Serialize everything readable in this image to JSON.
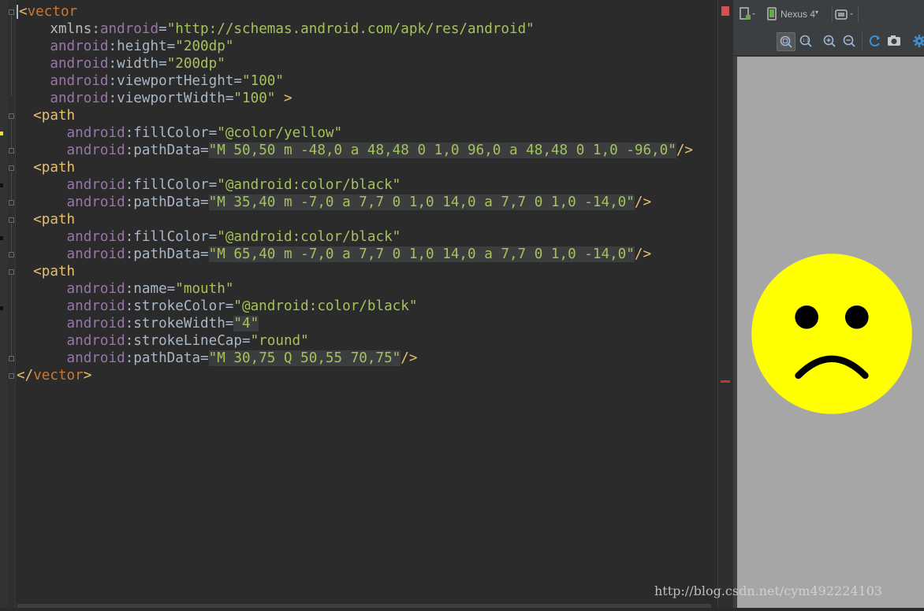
{
  "editor": {
    "lines": [
      [
        [
          "tag",
          "<"
        ],
        [
          "tag-red",
          "vector"
        ]
      ],
      [
        [
          "attr",
          "    xmlns"
        ],
        [
          "eq",
          ":"
        ],
        [
          "ns",
          "android"
        ],
        [
          "eq",
          "="
        ],
        [
          "str",
          "\"http://schemas.android.com/apk/res/android\""
        ]
      ],
      [
        [
          "ns",
          "    android"
        ],
        [
          "eq",
          ":height="
        ],
        [
          "str",
          "\"200dp\""
        ]
      ],
      [
        [
          "ns",
          "    android"
        ],
        [
          "eq",
          ":width="
        ],
        [
          "str",
          "\"200dp\""
        ]
      ],
      [
        [
          "ns",
          "    android"
        ],
        [
          "eq",
          ":viewportHeight="
        ],
        [
          "str",
          "\"100\""
        ]
      ],
      [
        [
          "ns",
          "    android"
        ],
        [
          "eq",
          ":viewportWidth="
        ],
        [
          "str",
          "\"100\""
        ],
        [
          "tag",
          " >"
        ]
      ],
      [
        [
          "tag",
          "  <path"
        ]
      ],
      [
        [
          "ns",
          "      android"
        ],
        [
          "eq",
          ":fillColor="
        ],
        [
          "str",
          "\"@color/yellow\""
        ]
      ],
      [
        [
          "ns",
          "      android"
        ],
        [
          "eq",
          ":pathData="
        ],
        [
          "qhl",
          "\"M 50,50 m -48,0 a 48,48 0 1,0 96,0 a 48,48 0 1,0 -96,0\""
        ],
        [
          "tag",
          "/>"
        ]
      ],
      [
        [
          "tag",
          "  <path"
        ]
      ],
      [
        [
          "ns",
          "      android"
        ],
        [
          "eq",
          ":fillColor="
        ],
        [
          "str",
          "\"@android:color/black\""
        ]
      ],
      [
        [
          "ns",
          "      android"
        ],
        [
          "eq",
          ":pathData="
        ],
        [
          "qhl",
          "\"M 35,40 m -7,0 a 7,7 0 1,0 14,0 a 7,7 0 1,0 -14,0\""
        ],
        [
          "tag",
          "/>"
        ]
      ],
      [
        [
          "tag",
          "  <path"
        ]
      ],
      [
        [
          "ns",
          "      android"
        ],
        [
          "eq",
          ":fillColor="
        ],
        [
          "str",
          "\"@android:color/black\""
        ]
      ],
      [
        [
          "ns",
          "      android"
        ],
        [
          "eq",
          ":pathData="
        ],
        [
          "qhl",
          "\"M 65,40 m -7,0 a 7,7 0 1,0 14,0 a 7,7 0 1,0 -14,0\""
        ],
        [
          "tag",
          "/>"
        ]
      ],
      [
        [
          "tag",
          "  <path"
        ]
      ],
      [
        [
          "ns",
          "      android"
        ],
        [
          "eq",
          ":name="
        ],
        [
          "str",
          "\"mouth\""
        ]
      ],
      [
        [
          "ns",
          "      android"
        ],
        [
          "eq",
          ":strokeColor="
        ],
        [
          "str",
          "\"@android:color/black\""
        ]
      ],
      [
        [
          "ns",
          "      android"
        ],
        [
          "eq",
          ":strokeWidth="
        ],
        [
          "qhl",
          "\"4\""
        ]
      ],
      [
        [
          "ns",
          "      android"
        ],
        [
          "eq",
          ":strokeLineCap="
        ],
        [
          "str",
          "\"round\""
        ]
      ],
      [
        [
          "ns",
          "      android"
        ],
        [
          "eq",
          ":pathData="
        ],
        [
          "qhl",
          "\"M 30,75 Q 50,55 70,75\""
        ],
        [
          "tag",
          "/>"
        ]
      ],
      [
        [
          "tag",
          "</"
        ],
        [
          "tag-red",
          "vector"
        ],
        [
          "tag",
          ">"
        ]
      ]
    ]
  },
  "preview": {
    "toolbar": {
      "device_label": "Nexus 4",
      "icons": [
        "file-icon",
        "device-icon",
        "orientation-icon",
        "zoom-fit-icon",
        "zoom-actual-icon",
        "zoom-in-icon",
        "zoom-out-icon",
        "refresh-icon",
        "screenshot-icon",
        "settings-icon"
      ]
    },
    "vector": {
      "face_color": "#ffff00",
      "feature_color": "#000000"
    }
  },
  "watermark": "http://blog.csdn.net/cym492224103"
}
